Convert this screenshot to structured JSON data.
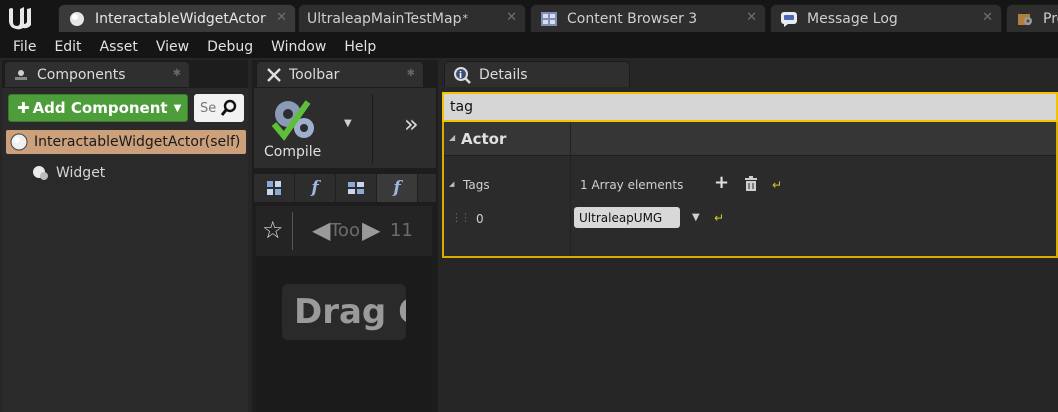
{
  "tabs": [
    {
      "label": "InteractableWidgetActor",
      "icon": "sphere-icon"
    },
    {
      "label": "UltraleapMainTestMap",
      "suffix": "*",
      "icon": ""
    },
    {
      "label": "Content Browser 3",
      "icon": "content-browser-icon"
    },
    {
      "label": "Message Log",
      "icon": "message-log-icon"
    },
    {
      "label": "Pro",
      "icon": "project-settings-icon"
    }
  ],
  "menu": [
    "File",
    "Edit",
    "Asset",
    "View",
    "Debug",
    "Window",
    "Help"
  ],
  "components": {
    "title": "Components",
    "add_label": "Add Component",
    "search_placeholder": "Se",
    "self_item": "InteractableWidgetActor(self)",
    "child_item": "Widget"
  },
  "toolbar": {
    "title": "Toolbar",
    "compile_label": "Compile",
    "graph_nav_text": "Too",
    "graph_nav_text2": "11",
    "graph_overlay": "Drag C"
  },
  "details": {
    "title": "Details",
    "search_value": "tag",
    "category": "Actor",
    "tags_label": "Tags",
    "tags_count": "1 Array elements",
    "element_index": "0",
    "element_value": "UltraleapUMG"
  },
  "colors": {
    "accent_yellow": "#f3c300",
    "add_green": "#4d9d3a",
    "selected_row": "#cba07a"
  }
}
